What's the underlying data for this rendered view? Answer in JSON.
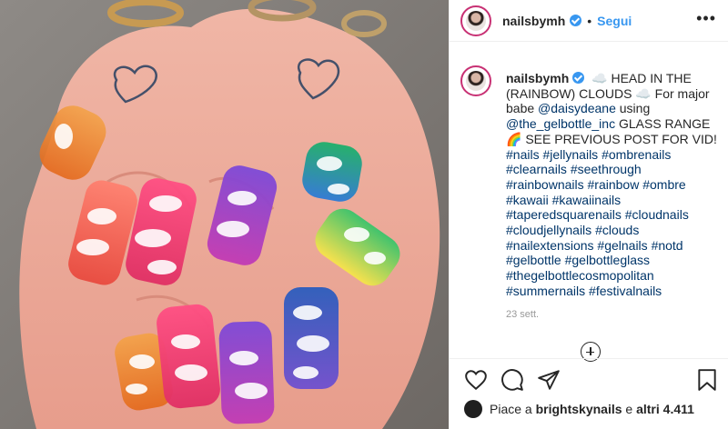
{
  "header": {
    "username": "nailsbymh",
    "separator": "•",
    "follow_label": "Segui",
    "more_icon": "more-options-icon"
  },
  "caption": {
    "username": "nailsbymh",
    "line1": "☁️ HEAD IN THE (RAINBOW) CLOUDS ☁️ For major babe",
    "mention1": "@daisydeane",
    "line2": "using",
    "mention2": "@the_gelbottle_inc",
    "line3": "GLASS RANGE 🌈 SEE PREVIOUS POST FOR VID!",
    "hashtags": [
      "#nails",
      "#jellynails",
      "#ombrenails",
      "#clearnails",
      "#seethrough",
      "#rainbownails",
      "#rainbow",
      "#ombre",
      "#kawaii",
      "#kawaiinails",
      "#taperedsquarenails",
      "#cloudnails",
      "#cloudjellynails",
      "#clouds",
      "#nailextensions",
      "#gelnails",
      "#notd",
      "#gelbottle",
      "#gelbottleglass",
      "#thegelbottlecosmopolitan",
      "#summernails",
      "#festivalnails"
    ],
    "date": "23 sett."
  },
  "actions": {
    "like_icon": "heart-icon",
    "comment_icon": "comment-icon",
    "share_icon": "share-icon",
    "save_icon": "bookmark-icon"
  },
  "likes": {
    "prefix": "Piace a",
    "user": "brightskynails",
    "conj": "e",
    "others": "altri 4.411"
  },
  "colors": {
    "accent": "#3897f0",
    "link": "#003569",
    "border": "#efefef"
  }
}
